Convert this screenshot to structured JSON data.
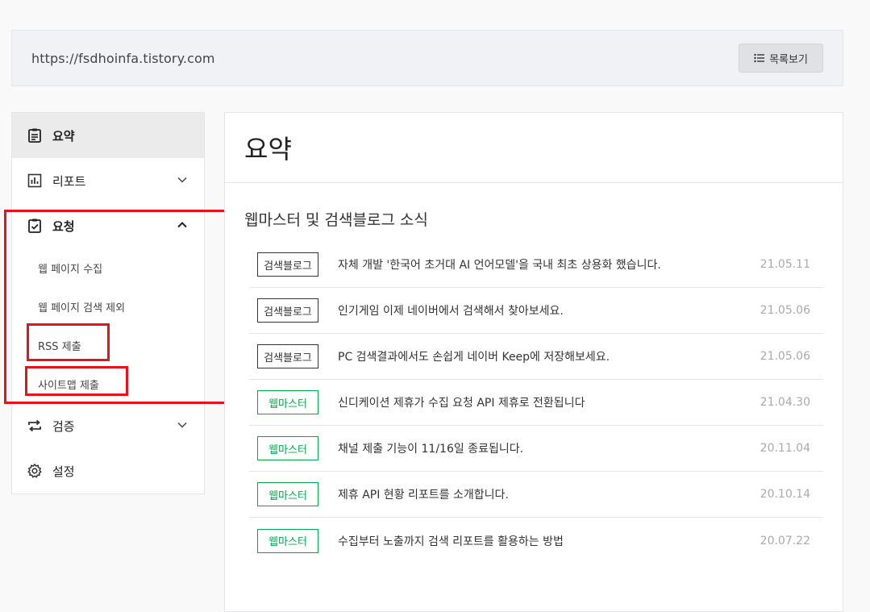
{
  "site": {
    "url": "https://fsdhoinfa.tistory.com",
    "list_button": "목록보기"
  },
  "sidebar": {
    "items": [
      {
        "label": "요약",
        "icon": "clipboard-icon",
        "active": true
      },
      {
        "label": "리포트",
        "icon": "bar-chart-icon",
        "expanded": false
      },
      {
        "label": "요청",
        "icon": "clipboard-check-icon",
        "expanded": true,
        "children": [
          "웹 페이지 수집",
          "웹 페이지 검색 제외",
          "RSS 제출",
          "사이트맵 제출"
        ]
      },
      {
        "label": "검증",
        "icon": "repeat-icon",
        "expanded": false
      },
      {
        "label": "설정",
        "icon": "gear-icon"
      }
    ]
  },
  "main": {
    "title": "요약",
    "section_title": "웹마스터 및 검색블로그 소식",
    "news": [
      {
        "tag": "검색블로그",
        "tag_color": "#333333",
        "text": "자체 개발 '한국어 초거대 AI 언어모델'을 국내 최초 상용화 했습니다.",
        "date": "21.05.11"
      },
      {
        "tag": "검색블로그",
        "tag_color": "#333333",
        "text": "인기게임 이제 네이버에서 검색해서 찾아보세요.",
        "date": "21.05.06"
      },
      {
        "tag": "검색블로그",
        "tag_color": "#333333",
        "text": "PC 검색결과에서도 손쉽게 네이버 Keep에 저장해보세요.",
        "date": "21.05.06"
      },
      {
        "tag": "웹마스터",
        "tag_color": "#03a94d",
        "text": "신디케이션 제휴가 수집 요청 API 제휴로 전환됩니다",
        "date": "21.04.30"
      },
      {
        "tag": "웹마스터",
        "tag_color": "#03a94d",
        "text": "채널 제출 기능이 11/16일 종료됩니다.",
        "date": "20.11.04"
      },
      {
        "tag": "웹마스터",
        "tag_color": "#03a94d",
        "text": "제휴 API 현황 리포트를 소개합니다.",
        "date": "20.10.14"
      },
      {
        "tag": "웹마스터",
        "tag_color": "#03a94d",
        "text": "수집부터 노출까지 검색 리포트를 활용하는 방법",
        "date": "20.07.22"
      }
    ]
  },
  "annotation_color": "#e3141c"
}
